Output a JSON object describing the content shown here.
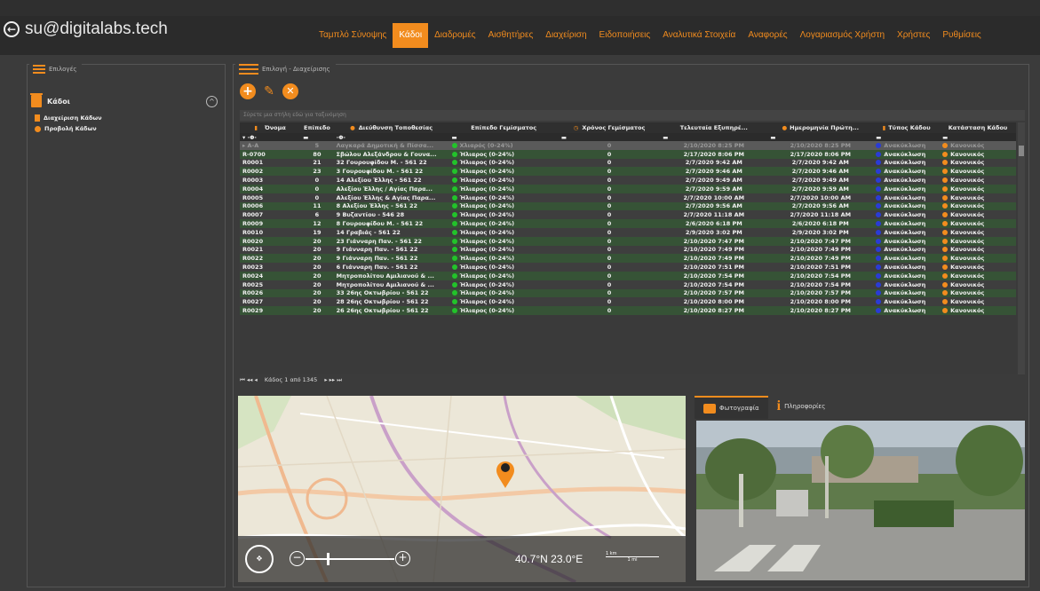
{
  "header": {
    "user_email": "su@digitalabs.tech",
    "nav": [
      {
        "label": "Ταμπλό Σύνοψης",
        "active": false
      },
      {
        "label": "Κάδοι",
        "active": true
      },
      {
        "label": "Διαδρομές",
        "active": false
      },
      {
        "label": "Αισθητήρες",
        "active": false
      },
      {
        "label": "Διαχείριση",
        "active": false
      },
      {
        "label": "Ειδοποιήσεις",
        "active": false
      },
      {
        "label": "Αναλυτικά Στοιχεία",
        "active": false
      },
      {
        "label": "Αναφορές",
        "active": false
      },
      {
        "label": "Λογαριασμός Χρήστη",
        "active": false
      },
      {
        "label": "Χρήστες",
        "active": false
      },
      {
        "label": "Ρυθμίσεις",
        "active": false
      }
    ]
  },
  "left_panel": {
    "header": "Επιλογές",
    "title": "Κάδοι",
    "items": [
      "Διαχείριση Κάδων",
      "Προβολή Κάδων"
    ]
  },
  "main_panel": {
    "header": "Επιλογή - Διαχείρισης",
    "group_hint": "Σύρετε μια στήλη εδώ για ταξινόμηση",
    "columns": [
      "Όνομα",
      "Επίπεδο",
      "Διεύθυνση Τοποθεσίας",
      "Επίπεδο Γεμίσματος",
      "Χρόνος Γεμίσματος",
      "Τελευταία Εξυπηρέ...",
      "Ημερομηνία Πρώτη...",
      "Τύπος Κάδου",
      "Κατάσταση Κάδου"
    ],
    "rows": [
      {
        "name": "A-A",
        "level": "5",
        "address": "Λαγκαρά Δημοτική & Πίσσα...",
        "fill": "Χλιαρός (0-24%)",
        "fill_time": "0",
        "last_service": "2/10/2020 8:25 PM",
        "first_date": "2/10/2020 8:25 PM",
        "type": "Ανακύκλωση",
        "status": "Κανονικός"
      },
      {
        "name": "R-0700",
        "level": "80",
        "address": "Σβώλου Αλεξάνδρου & Γουνα...",
        "fill": "Ήλιαρος (0-24%)",
        "fill_time": "0",
        "last_service": "2/17/2020 8:06 PM",
        "first_date": "2/17/2020 8:06 PM",
        "type": "Ανακύκλωση",
        "status": "Κανονικός"
      },
      {
        "name": "R0001",
        "level": "21",
        "address": "32 Γουρουφίδου Μ. - 561 22",
        "fill": "Ήλιαρος (0-24%)",
        "fill_time": "0",
        "last_service": "2/7/2020 9:42 AM",
        "first_date": "2/7/2020 9:42 AM",
        "type": "Ανακύκλωση",
        "status": "Κανονικός"
      },
      {
        "name": "R0002",
        "level": "23",
        "address": "3 Γουρουφίδου Μ. - 561 22",
        "fill": "Ήλιαρος (0-24%)",
        "fill_time": "0",
        "last_service": "2/7/2020 9:46 AM",
        "first_date": "2/7/2020 9:46 AM",
        "type": "Ανακύκλωση",
        "status": "Κανονικός"
      },
      {
        "name": "R0003",
        "level": "0",
        "address": "14 Αλεξίου Έλλης - 561 22",
        "fill": "Ήλιαρος (0-24%)",
        "fill_time": "0",
        "last_service": "2/7/2020 9:49 AM",
        "first_date": "2/7/2020 9:49 AM",
        "type": "Ανακύκλωση",
        "status": "Κανονικός"
      },
      {
        "name": "R0004",
        "level": "0",
        "address": "Αλεξίου Έλλης / Αγίας Παρα...",
        "fill": "Ήλιαρος (0-24%)",
        "fill_time": "0",
        "last_service": "2/7/2020 9:59 AM",
        "first_date": "2/7/2020 9:59 AM",
        "type": "Ανακύκλωση",
        "status": "Κανονικός"
      },
      {
        "name": "R0005",
        "level": "0",
        "address": "Αλεξίου Έλλης & Αγίας Παρα...",
        "fill": "Ήλιαρος (0-24%)",
        "fill_time": "0",
        "last_service": "2/7/2020 10:00 AM",
        "first_date": "2/7/2020 10:00 AM",
        "type": "Ανακύκλωση",
        "status": "Κανονικός"
      },
      {
        "name": "R0006",
        "level": "11",
        "address": "8 Αλεξίου Έλλης - 561 22",
        "fill": "Ήλιαρος (0-24%)",
        "fill_time": "0",
        "last_service": "2/7/2020 9:56 AM",
        "first_date": "2/7/2020 9:56 AM",
        "type": "Ανακύκλωση",
        "status": "Κανονικός"
      },
      {
        "name": "R0007",
        "level": "6",
        "address": "9 Βυζαντίου - 546 28",
        "fill": "Ήλιαρος (0-24%)",
        "fill_time": "0",
        "last_service": "2/7/2020 11:18 AM",
        "first_date": "2/7/2020 11:18 AM",
        "type": "Ανακύκλωση",
        "status": "Κανονικός"
      },
      {
        "name": "R0009",
        "level": "12",
        "address": "8 Γουρουφίδου Μ. - 561 22",
        "fill": "Ήλιαρος (0-24%)",
        "fill_time": "0",
        "last_service": "2/6/2020 6:18 PM",
        "first_date": "2/6/2020 6:18 PM",
        "type": "Ανακύκλωση",
        "status": "Κανονικός"
      },
      {
        "name": "R0010",
        "level": "19",
        "address": "14 Γραβιάς - 561 22",
        "fill": "Ήλιαρος (0-24%)",
        "fill_time": "0",
        "last_service": "2/9/2020 3:02 PM",
        "first_date": "2/9/2020 3:02 PM",
        "type": "Ανακύκλωση",
        "status": "Κανονικός"
      },
      {
        "name": "R0020",
        "level": "20",
        "address": "23 Γιάνναρη Παν. - 561 22",
        "fill": "Ήλιαρος (0-24%)",
        "fill_time": "0",
        "last_service": "2/10/2020 7:47 PM",
        "first_date": "2/10/2020 7:47 PM",
        "type": "Ανακύκλωση",
        "status": "Κανονικός"
      },
      {
        "name": "R0021",
        "level": "20",
        "address": "9 Γιάνναρη Παν. - 561 22",
        "fill": "Ήλιαρος (0-24%)",
        "fill_time": "0",
        "last_service": "2/10/2020 7:49 PM",
        "first_date": "2/10/2020 7:49 PM",
        "type": "Ανακύκλωση",
        "status": "Κανονικός"
      },
      {
        "name": "R0022",
        "level": "20",
        "address": "9 Γιάνναρη Παν. - 561 22",
        "fill": "Ήλιαρος (0-24%)",
        "fill_time": "0",
        "last_service": "2/10/2020 7:49 PM",
        "first_date": "2/10/2020 7:49 PM",
        "type": "Ανακύκλωση",
        "status": "Κανονικός"
      },
      {
        "name": "R0023",
        "level": "20",
        "address": "6 Γιάνναρη Παν. - 561 22",
        "fill": "Ήλιαρος (0-24%)",
        "fill_time": "0",
        "last_service": "2/10/2020 7:51 PM",
        "first_date": "2/10/2020 7:51 PM",
        "type": "Ανακύκλωση",
        "status": "Κανονικός"
      },
      {
        "name": "R0024",
        "level": "20",
        "address": "Μητροπολίτου Αμιλιανού & ...",
        "fill": "Ήλιαρος (0-24%)",
        "fill_time": "0",
        "last_service": "2/10/2020 7:54 PM",
        "first_date": "2/10/2020 7:54 PM",
        "type": "Ανακύκλωση",
        "status": "Κανονικός"
      },
      {
        "name": "R0025",
        "level": "20",
        "address": "Μητροπολίτου Αμιλιανού & ...",
        "fill": "Ήλιαρος (0-24%)",
        "fill_time": "0",
        "last_service": "2/10/2020 7:54 PM",
        "first_date": "2/10/2020 7:54 PM",
        "type": "Ανακύκλωση",
        "status": "Κανονικός"
      },
      {
        "name": "R0026",
        "level": "20",
        "address": "33 26ης Οκτωβρίου - 561 22",
        "fill": "Ήλιαρος (0-24%)",
        "fill_time": "0",
        "last_service": "2/10/2020 7:57 PM",
        "first_date": "2/10/2020 7:57 PM",
        "type": "Ανακύκλωση",
        "status": "Κανονικός"
      },
      {
        "name": "R0027",
        "level": "20",
        "address": "28 26ης Οκτωβρίου - 561 22",
        "fill": "Ήλιαρος (0-24%)",
        "fill_time": "0",
        "last_service": "2/10/2020 8:00 PM",
        "first_date": "2/10/2020 8:00 PM",
        "type": "Ανακύκλωση",
        "status": "Κανονικός"
      },
      {
        "name": "R0029",
        "level": "20",
        "address": "26 26ης Οκτωβρίου - 561 22",
        "fill": "Ήλιαρος (0-24%)",
        "fill_time": "0",
        "last_service": "2/10/2020 8:27 PM",
        "first_date": "2/10/2020 8:27 PM",
        "type": "Ανακύκλωση",
        "status": "Κανονικός"
      }
    ],
    "pager_text": "Κάδος 1 από 1345"
  },
  "map": {
    "coords": "40.7°N  23.0°E",
    "scale_km": "1 km",
    "scale_mi": "1 mi"
  },
  "details": {
    "tabs": [
      "Φωτογραφία",
      "Πληροφορίες"
    ]
  },
  "colors": {
    "accent": "#f28c1e",
    "status_green": "#22c32a",
    "type_blue": "#2a3bd6"
  }
}
